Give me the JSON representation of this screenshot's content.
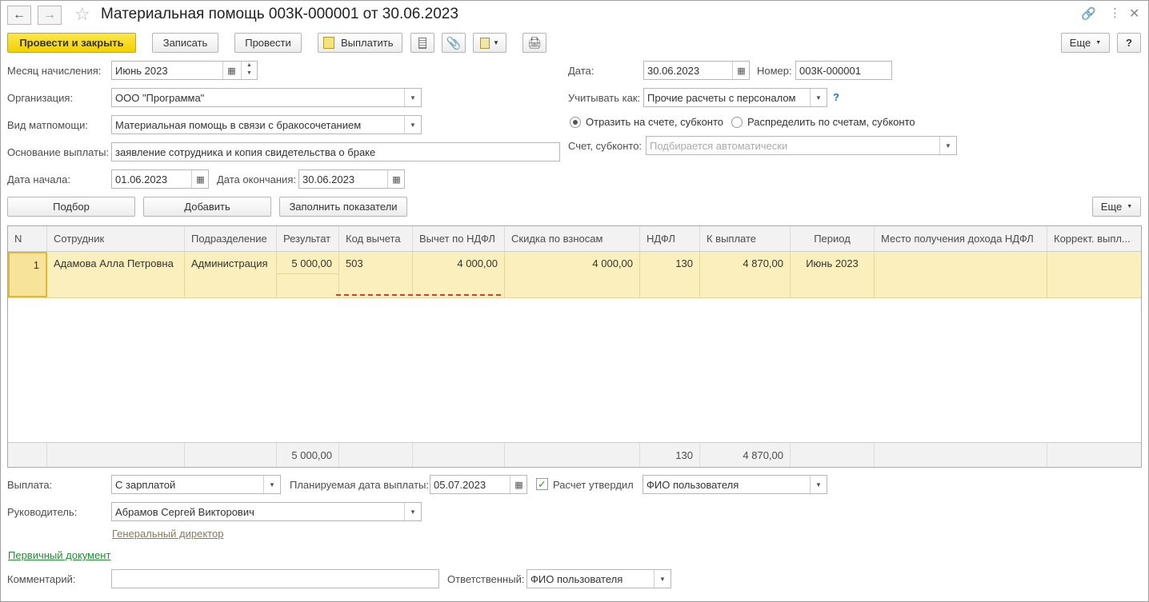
{
  "window": {
    "title": "Материальная помощь 003К-000001 от 30.06.2023"
  },
  "toolbar": {
    "post_close": "Провести и закрыть",
    "save": "Записать",
    "post": "Провести",
    "pay": "Выплатить",
    "more": "Еще",
    "help": "?"
  },
  "form": {
    "month_label": "Месяц начисления:",
    "month_value": "Июнь 2023",
    "date_label": "Дата:",
    "date_value": "30.06.2023",
    "number_label": "Номер:",
    "number_value": "003К-000001",
    "org_label": "Организация:",
    "org_value": "ООО \"Программа\"",
    "account_as_label": "Учитывать как:",
    "account_as_value": "Прочие расчеты с персоналом",
    "help_q": "?",
    "radio1": "Отразить на счете, субконто",
    "radio2": "Распределить по счетам, субконто",
    "kind_label": "Вид матпомощи:",
    "kind_value": "Материальная помощь в связи с бракосочетанием",
    "reason_label": "Основание выплаты:",
    "reason_value": "заявление сотрудника и копия свидетельства о браке",
    "subconto_label": "Счет, субконто:",
    "subconto_placeholder": "Подбирается автоматически",
    "start_label": "Дата начала:",
    "start_value": "01.06.2023",
    "end_label": "Дата окончания:",
    "end_value": "30.06.2023"
  },
  "table_toolbar": {
    "pick": "Подбор",
    "add": "Добавить",
    "fill": "Заполнить показатели",
    "more": "Еще"
  },
  "table": {
    "headers": [
      "N",
      "Сотрудник",
      "Подразделение",
      "Результат",
      "Код вычета",
      "Вычет по НДФЛ",
      "Скидка по взносам",
      "НДФЛ",
      "К выплате",
      "Период",
      "Место получения дохода НДФЛ",
      "Коррект. выпл..."
    ],
    "rows": [
      [
        "1",
        "Адамова Алла Петровна",
        "Администрация",
        "5 000,00",
        "503",
        "4 000,00",
        "4 000,00",
        "130",
        "4 870,00",
        "Июнь 2023",
        "",
        ""
      ]
    ],
    "totals": {
      "result": "5 000,00",
      "ndfl": "130",
      "payout": "4 870,00"
    }
  },
  "footer": {
    "payment_label": "Выплата:",
    "payment_value": "С зарплатой",
    "planned_label": "Планируемая дата выплаты:",
    "planned_value": "05.07.2023",
    "approved_label": "Расчет утвердил",
    "approved_value": "ФИО пользователя",
    "head_label": "Руководитель:",
    "head_value": "Абрамов Сергей Викторович",
    "head_position": "Генеральный директор",
    "primary_doc": "Первичный документ",
    "comment_label": "Комментарий:",
    "comment_value": "",
    "responsible_label": "Ответственный:",
    "responsible_value": "ФИО пользователя"
  }
}
